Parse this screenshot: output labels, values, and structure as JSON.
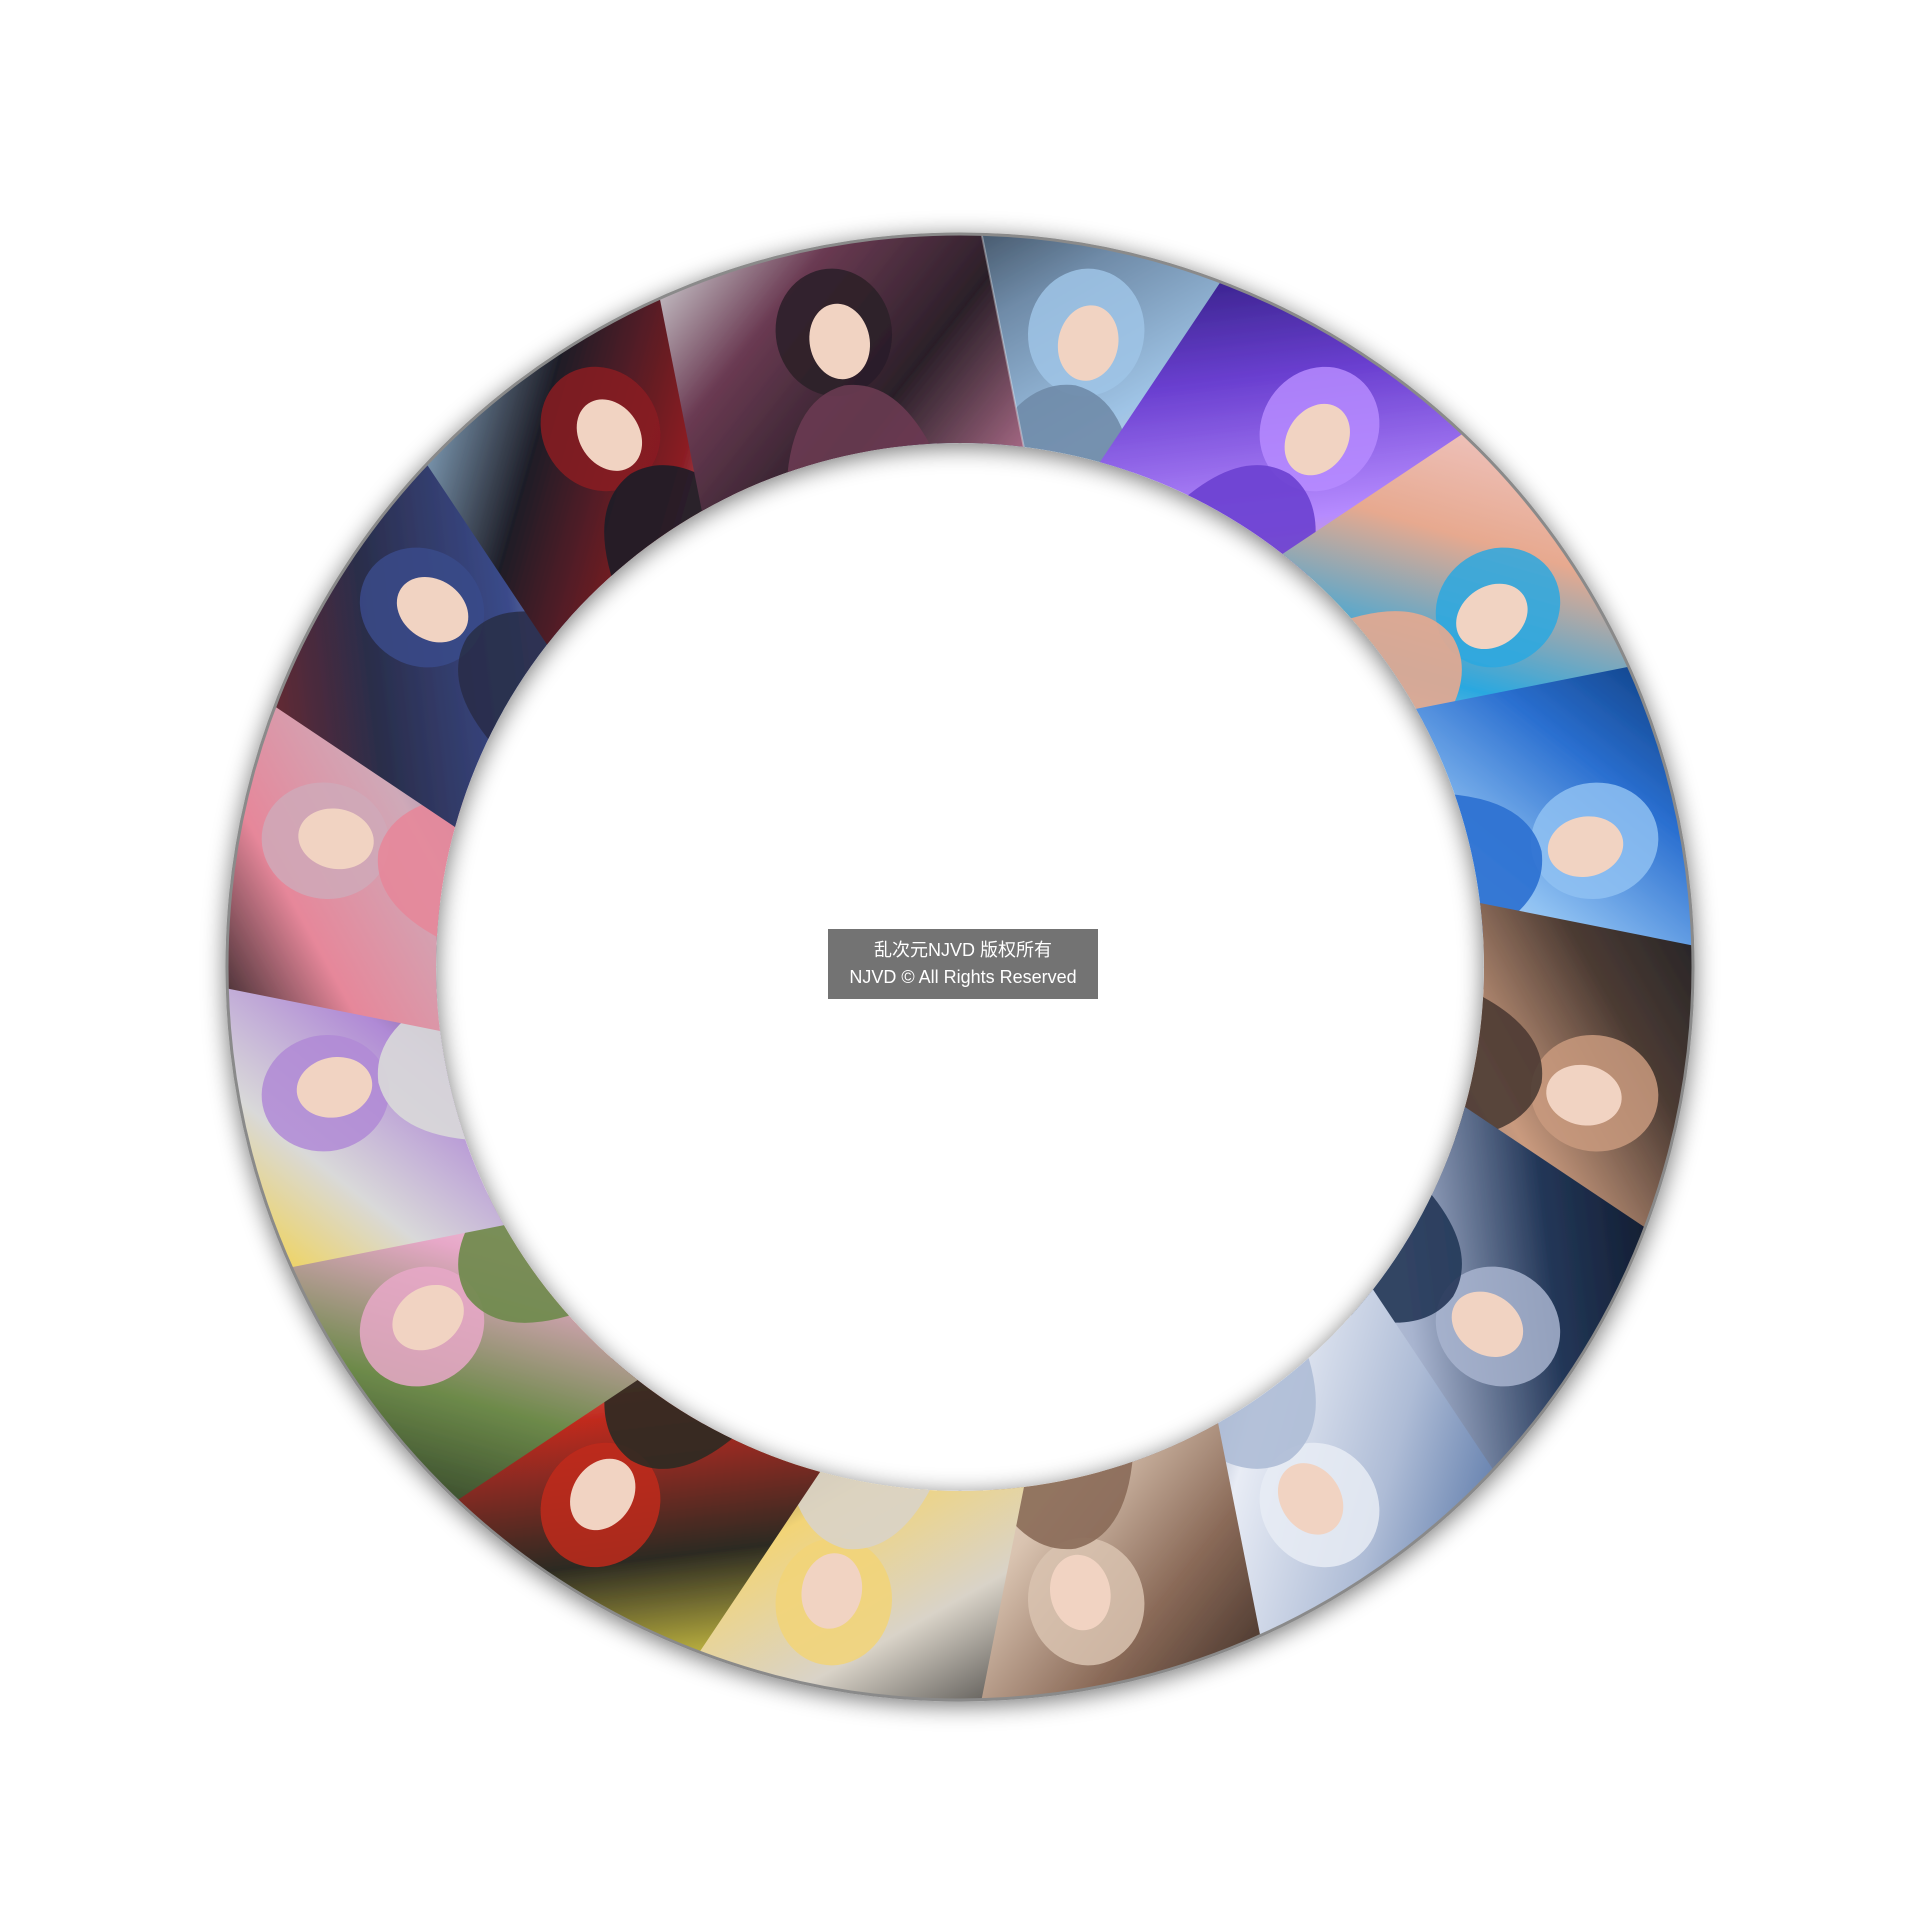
{
  "watermark": {
    "line1": "乱次元NJVD 版权所有",
    "line2": "NJVD © All Rights Reserved",
    "background": "#737373",
    "text_color": "#ffffff"
  },
  "ring": {
    "outer_border_color": "#8a8a8a",
    "inner_color": "#ffffff",
    "shadow_color": "#000000"
  },
  "photos": [
    {
      "subject": "lavender-haired cosplayer",
      "colors": [
        "#2a3542",
        "#6f8ba8",
        "#9fc4e6",
        "#e8d9cf"
      ]
    },
    {
      "subject": "purple stage cosplayer",
      "colors": [
        "#2a1b78",
        "#6a3fd0",
        "#b68bff",
        "#ffd43b"
      ]
    },
    {
      "subject": "blonde cosplayer in blue",
      "colors": [
        "#f0c9c9",
        "#e7a98f",
        "#2aa8e0",
        "#f5e6dc"
      ]
    },
    {
      "subject": "cosplayer in blue light",
      "colors": [
        "#0d3a7a",
        "#2a6fd0",
        "#8fc1f2",
        "#e9f1fb"
      ]
    },
    {
      "subject": "brown-haired cosplayer in black",
      "colors": [
        "#1b1e24",
        "#4c3b33",
        "#c99a7e",
        "#6a6f77"
      ]
    },
    {
      "subject": "silver-haired cosplayer on dark",
      "colors": [
        "#0d1424",
        "#233758",
        "#a8b4cf",
        "#d9dfeb"
      ]
    },
    {
      "subject": "silver-haired cosplayer in white",
      "colors": [
        "#4f6fa2",
        "#aebcd6",
        "#e8ecf5",
        "#29406e"
      ]
    },
    {
      "subject": "cosplayer with lace",
      "colors": [
        "#3b2b24",
        "#8a6a58",
        "#d9c3b0",
        "#f1e7dc"
      ]
    },
    {
      "subject": "blonde cosplayer in white",
      "colors": [
        "#3c3a38",
        "#d9d3c8",
        "#f2d477",
        "#1a1a1a"
      ]
    },
    {
      "subject": "blonde cosplayer with rose",
      "colors": [
        "#f4e64a",
        "#2c2a22",
        "#c0291f",
        "#f2d7b8"
      ]
    },
    {
      "subject": "pink-haired cosplayer in green",
      "colors": [
        "#2b3b25",
        "#6d8a4a",
        "#e7a8c8",
        "#f5eef2"
      ]
    },
    {
      "subject": "cosplayer with bunny ears",
      "colors": [
        "#f6d23a",
        "#d9d9d9",
        "#b08ad6",
        "#3a2e34"
      ]
    },
    {
      "subject": "pink-haired cosplayer",
      "colors": [
        "#141414",
        "#e6879a",
        "#cfa9b8",
        "#5a6da8"
      ]
    },
    {
      "subject": "black-haired cosplayer in blue",
      "colors": [
        "#7a2a2a",
        "#2a2d4a",
        "#3a4a8a",
        "#e5e5e8"
      ]
    },
    {
      "subject": "gothic cosplayer",
      "colors": [
        "#9cc2e0",
        "#1e1e28",
        "#8a1a22",
        "#dfe7ef"
      ]
    },
    {
      "subject": "cosplayer with wavy hair",
      "colors": [
        "#dfe6e6",
        "#6a3a52",
        "#2a1f28",
        "#a86a86"
      ]
    }
  ]
}
